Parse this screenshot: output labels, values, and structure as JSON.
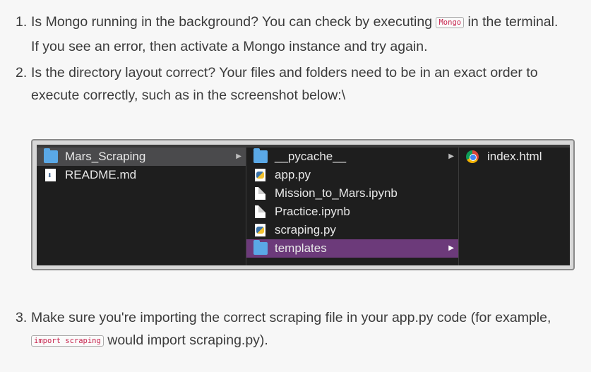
{
  "items": [
    {
      "number": "1.",
      "line1_before": "Is Mongo running in the background? You can check by executing ",
      "code": "Mongo",
      "line1_after": " in the terminal.",
      "line2": "If you see an error, then activate a Mongo instance and try again."
    },
    {
      "number": "2.",
      "line1": "Is the directory layout correct? Your files and folders need to be in an exact order to",
      "line2": "execute correctly, such as in the screenshot below:\\"
    },
    {
      "number": "3.",
      "line1": "Make sure you're importing the correct scraping file in your app.py code (for example,",
      "code": "import scraping",
      "line2_after": " would import scraping.py)."
    }
  ],
  "finder": {
    "column1": [
      {
        "name": "Mars_Scraping",
        "icon": "folder-icon",
        "selected": true
      },
      {
        "name": "README.md",
        "icon": "markdown-file-icon"
      }
    ],
    "column2": [
      {
        "name": "__pycache__",
        "icon": "folder-icon"
      },
      {
        "name": "app.py",
        "icon": "python-file-icon"
      },
      {
        "name": "Mission_to_Mars.ipynb",
        "icon": "document-icon"
      },
      {
        "name": "Practice.ipynb",
        "icon": "document-icon"
      },
      {
        "name": "scraping.py",
        "icon": "python-file-icon"
      },
      {
        "name": "templates",
        "icon": "folder-icon",
        "selected": true
      }
    ],
    "column3": [
      {
        "name": "index.html",
        "icon": "chrome-html-icon"
      }
    ],
    "arrow_glyph": "▶",
    "colors": {
      "background": "#1e1e1e",
      "selected_parent": "#4a4a4c",
      "selected_active": "#6c3a7a",
      "folder": "#5aa8e6"
    }
  }
}
